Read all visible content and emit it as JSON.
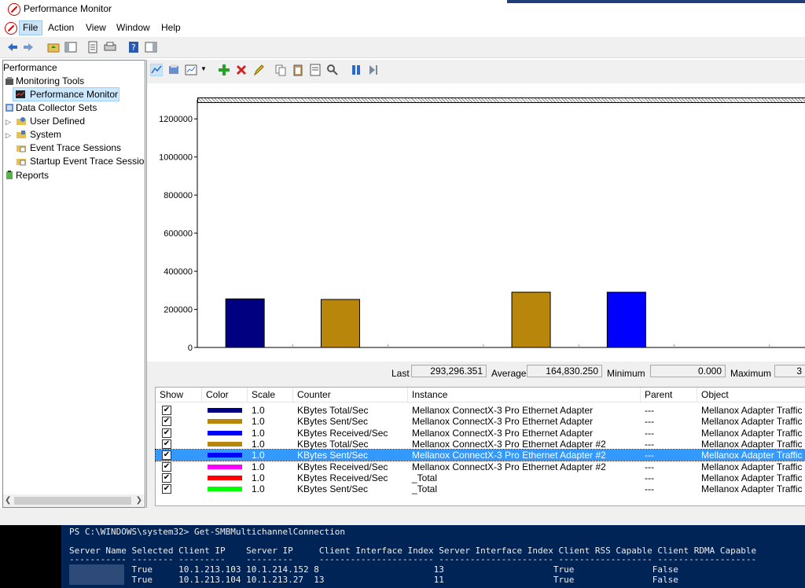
{
  "window": {
    "title": "Performance Monitor"
  },
  "menu": [
    "File",
    "Action",
    "View",
    "Window",
    "Help"
  ],
  "tree": {
    "items": [
      {
        "label": "Performance",
        "icon": "performance-icon"
      },
      {
        "label": "Monitoring Tools",
        "icon": "monitoring-tools-icon"
      },
      {
        "label": "Performance Monitor",
        "icon": "performance-monitor-icon",
        "selected": true
      },
      {
        "label": "Data Collector Sets",
        "icon": "data-collector-sets-icon"
      },
      {
        "label": "User Defined",
        "icon": "folder-icon"
      },
      {
        "label": "System",
        "icon": "folder-icon"
      },
      {
        "label": "Event Trace Sessions",
        "icon": "trace-icon"
      },
      {
        "label": "Startup Event Trace Sessions",
        "icon": "trace-icon"
      },
      {
        "label": "Reports",
        "icon": "reports-icon"
      }
    ]
  },
  "stats": {
    "last_label": "Last",
    "last_value": "293,296.351",
    "average_label": "Average",
    "average_value": "164,830.250",
    "minimum_label": "Minimum",
    "minimum_value": "0.000",
    "maximum_label": "Maximum",
    "maximum_value": "3"
  },
  "chart_data": {
    "type": "bar",
    "yticks": [
      0,
      200000,
      400000,
      600000,
      800000,
      1000000,
      1200000
    ],
    "ytick_labels": [
      "0",
      "200000",
      "400000",
      "600000",
      "800000",
      "1000000",
      "1200000"
    ],
    "ylim": [
      0,
      1300000
    ],
    "values": [
      255000,
      252000,
      0,
      290000,
      290000,
      0,
      0
    ],
    "colors": [
      "#000080",
      "#b8860b",
      "#0000ff",
      "#b8860b",
      "#0000ff",
      "#ff00ff",
      "#ff0000"
    ],
    "grid": true
  },
  "legend": {
    "headers": [
      "Show",
      "Color",
      "Scale",
      "Counter",
      "Instance",
      "Parent",
      "Object"
    ],
    "rows": [
      {
        "color": "#000080",
        "scale": "1.0",
        "counter": "KBytes Total/Sec",
        "instance": "Mellanox ConnectX-3 Pro Ethernet Adapter",
        "parent": "---",
        "object": "Mellanox Adapter Traffic ..."
      },
      {
        "color": "#b8860b",
        "scale": "1.0",
        "counter": "KBytes Sent/Sec",
        "instance": "Mellanox ConnectX-3 Pro Ethernet Adapter",
        "parent": "---",
        "object": "Mellanox Adapter Traffic ..."
      },
      {
        "color": "#0000ff",
        "scale": "1.0",
        "counter": "KBytes Received/Sec",
        "instance": "Mellanox ConnectX-3 Pro Ethernet Adapter",
        "parent": "---",
        "object": "Mellanox Adapter Traffic ..."
      },
      {
        "color": "#b8860b",
        "scale": "1.0",
        "counter": "KBytes Total/Sec",
        "instance": "Mellanox ConnectX-3 Pro Ethernet Adapter #2",
        "parent": "---",
        "object": "Mellanox Adapter Traffic ..."
      },
      {
        "color": "#0000ff",
        "scale": "1.0",
        "counter": "KBytes Sent/Sec",
        "instance": "Mellanox ConnectX-3 Pro Ethernet Adapter #2",
        "parent": "---",
        "object": "Mellanox Adapter Traffic ...",
        "selected": true
      },
      {
        "color": "#ff00ff",
        "scale": "1.0",
        "counter": "KBytes Received/Sec",
        "instance": "Mellanox ConnectX-3 Pro Ethernet Adapter #2",
        "parent": "---",
        "object": "Mellanox Adapter Traffic ..."
      },
      {
        "color": "#ff0000",
        "scale": "1.0",
        "counter": "KBytes Received/Sec",
        "instance": "_Total",
        "parent": "---",
        "object": "Mellanox Adapter Traffic ..."
      },
      {
        "color": "#00ff00",
        "scale": "1.0",
        "counter": "KBytes Sent/Sec",
        "instance": "_Total",
        "parent": "---",
        "object": "Mellanox Adapter Traffic ..."
      }
    ]
  },
  "powershell": {
    "prompt": "PS C:\\WINDOWS\\system32> Get-SMBMultichannelConnection",
    "header": "Server Name Selected Client IP    Server IP     Client Interface Index Server Interface Index Client RSS Capable Client RDMA Capable",
    "underline": "----------- -------- ---------    ---------     ---------------------- ---------------------- ------------------ -------------------",
    "rows": [
      "            True     10.1.213.103 10.1.214.152 8                      13                     True               False",
      "            True     10.1.213.104 10.1.213.27  13                     11                     True               False"
    ]
  }
}
